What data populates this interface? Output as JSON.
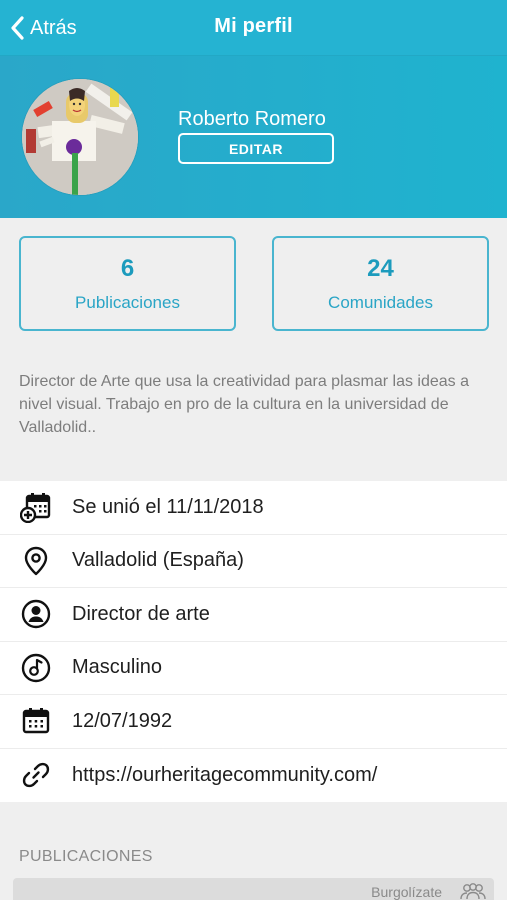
{
  "nav": {
    "back_label": "Atrás",
    "title": "Mi perfil"
  },
  "profile": {
    "name": "Roberto Romero",
    "edit_label": "EDITAR"
  },
  "stats": [
    {
      "value": "6",
      "label": "Publicaciones"
    },
    {
      "value": "24",
      "label": "Comunidades"
    }
  ],
  "bio": "Director de Arte que usa la creatividad para plasmar las ideas a nivel visual. Trabajo en pro de la cultura en la universidad de Valladolid..",
  "info": [
    {
      "icon": "calendar-add-icon",
      "text": "Se unió el 11/11/2018"
    },
    {
      "icon": "location-pin-icon",
      "text": "Valladolid (España)"
    },
    {
      "icon": "person-circle-icon",
      "text": "Director de arte"
    },
    {
      "icon": "gender-icon",
      "text": "Masculino"
    },
    {
      "icon": "calendar-icon",
      "text": "12/07/1992"
    },
    {
      "icon": "link-icon",
      "text": "https://ourheritagecommunity.com/"
    }
  ],
  "posts_section": {
    "title": "PUBLICACIONES",
    "first_post_community": "Burgolízate"
  },
  "colors": {
    "accent": "#25b3d2",
    "stat_border": "#49b5cf",
    "stat_text": "#1c9bbd"
  }
}
